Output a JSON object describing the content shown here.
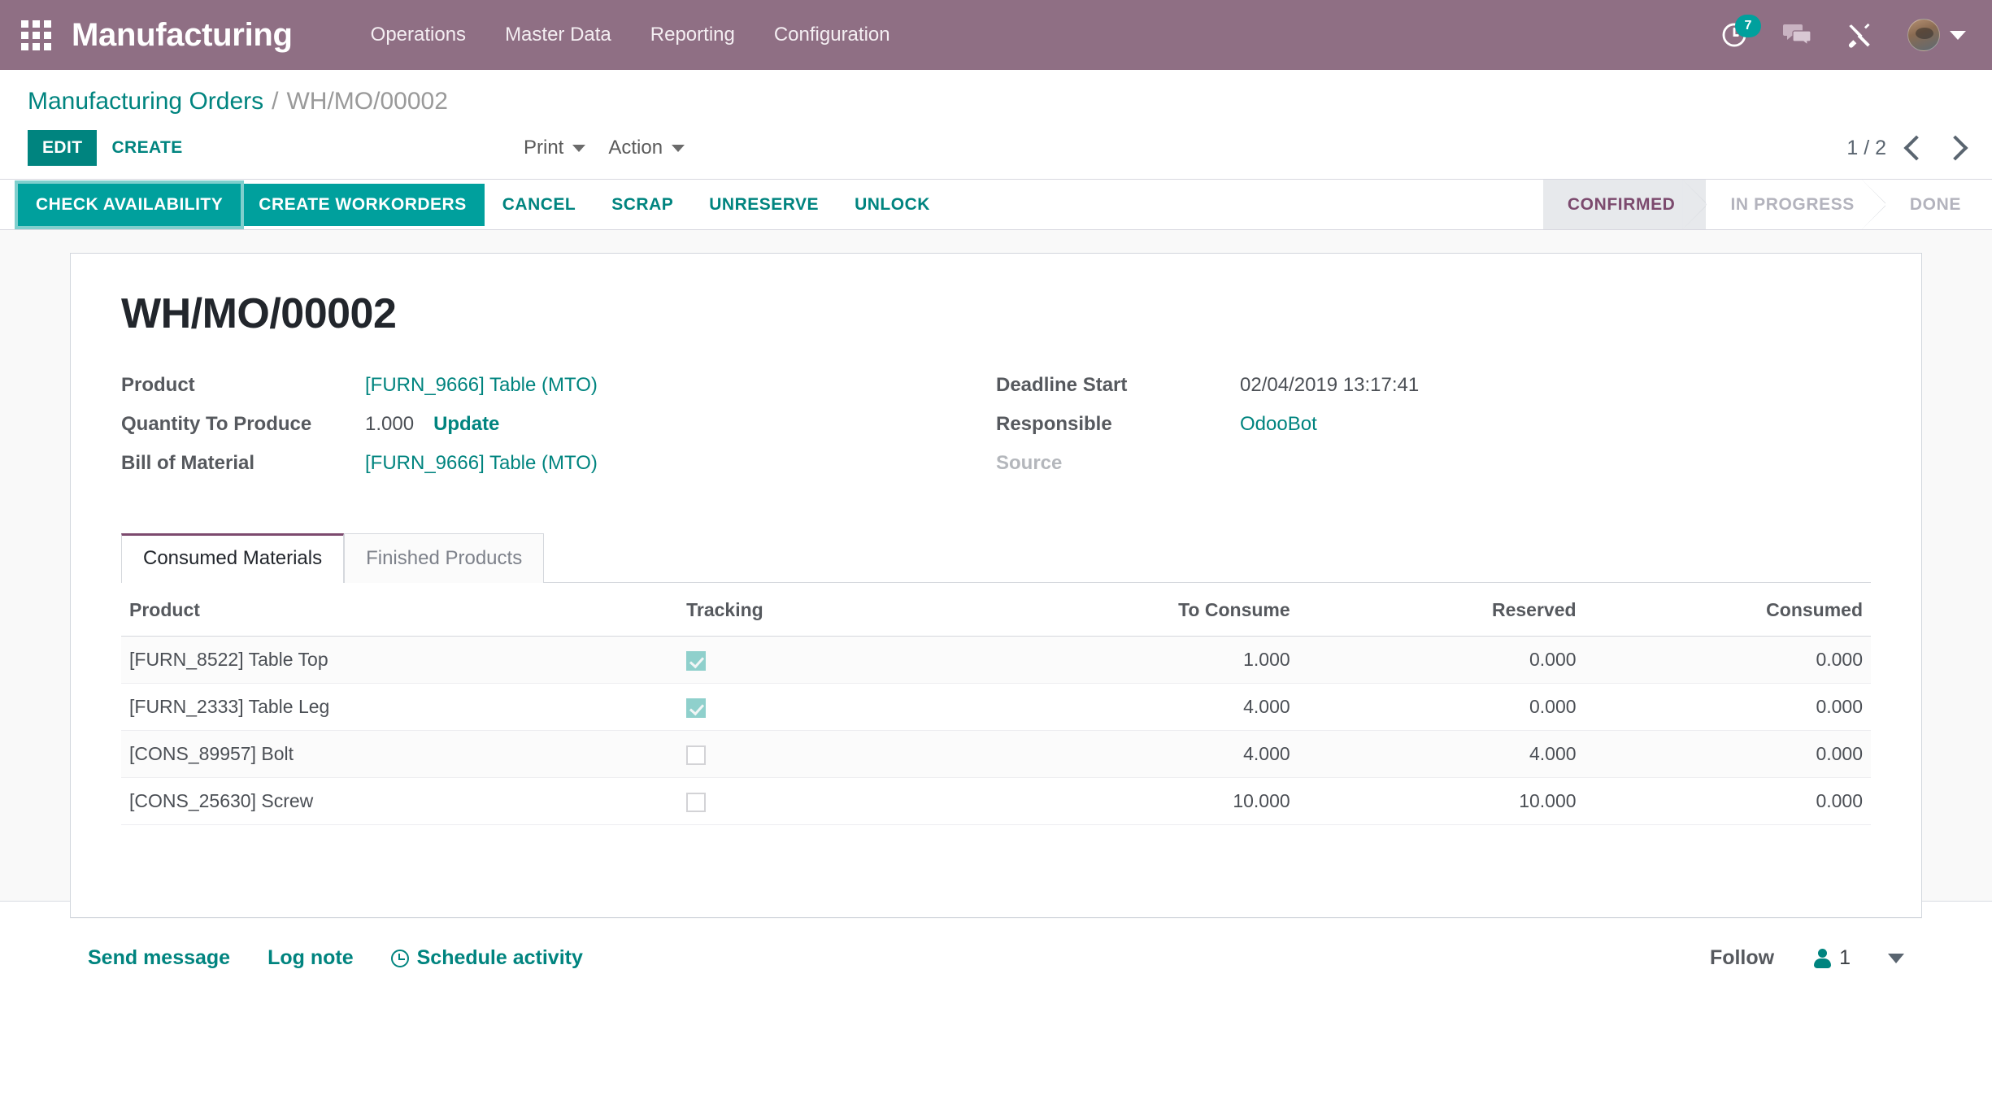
{
  "navbar": {
    "apps_icon": "apps-grid-icon",
    "brand": "Manufacturing",
    "menus": [
      {
        "label": "Operations"
      },
      {
        "label": "Master Data"
      },
      {
        "label": "Reporting"
      },
      {
        "label": "Configuration"
      }
    ],
    "activities_icon": "clock-icon",
    "activities_count": "7",
    "messages_icon": "chat-bubbles-icon",
    "debug_icon": "tools-icon",
    "avatar": "user-avatar",
    "user_caret": "chevron-down-icon"
  },
  "breadcrumb": {
    "root": "Manufacturing Orders",
    "separator": "/",
    "current": "WH/MO/00002"
  },
  "control_panel": {
    "edit_label": "EDIT",
    "create_label": "CREATE",
    "print_label": "Print",
    "action_label": "Action",
    "pager": "1 / 2",
    "prev_icon": "chevron-left-icon",
    "next_icon": "chevron-right-icon"
  },
  "status_bar": {
    "buttons": [
      {
        "label": "CHECK AVAILABILITY",
        "style": "focused"
      },
      {
        "label": "CREATE WORKORDERS",
        "style": "primary"
      },
      {
        "label": "CANCEL",
        "style": "link"
      },
      {
        "label": "SCRAP",
        "style": "link"
      },
      {
        "label": "UNRESERVE",
        "style": "link"
      },
      {
        "label": "UNLOCK",
        "style": "link"
      }
    ],
    "stages": [
      {
        "label": "CONFIRMED",
        "active": true
      },
      {
        "label": "IN PROGRESS",
        "active": false
      },
      {
        "label": "DONE",
        "active": false
      }
    ]
  },
  "form": {
    "record_title": "WH/MO/00002",
    "left_fields": [
      {
        "label": "Product",
        "value": "[FURN_9666] Table (MTO)",
        "kind": "link"
      },
      {
        "label": "Quantity To Produce",
        "value": "1.000",
        "kind": "plain",
        "extra_link": "Update"
      },
      {
        "label": "Bill of Material",
        "value": "[FURN_9666] Table (MTO)",
        "kind": "link"
      }
    ],
    "right_fields": [
      {
        "label": "Deadline Start",
        "value": "02/04/2019 13:17:41",
        "kind": "plain"
      },
      {
        "label": "Responsible",
        "value": "OdooBot",
        "kind": "link"
      },
      {
        "label": "Source",
        "value": "",
        "kind": "empty"
      }
    ]
  },
  "tabs": [
    {
      "label": "Consumed Materials",
      "active": true
    },
    {
      "label": "Finished Products",
      "active": false
    }
  ],
  "lines_table": {
    "columns": [
      "Product",
      "Tracking",
      "To Consume",
      "Reserved",
      "Consumed"
    ],
    "rows": [
      {
        "product": "[FURN_8522] Table Top",
        "tracking": true,
        "to_consume": "1.000",
        "reserved": "0.000",
        "consumed": "0.000",
        "danger": true
      },
      {
        "product": "[FURN_2333] Table Leg",
        "tracking": true,
        "to_consume": "4.000",
        "reserved": "0.000",
        "consumed": "0.000",
        "danger": true
      },
      {
        "product": "[CONS_89957] Bolt",
        "tracking": false,
        "to_consume": "4.000",
        "reserved": "4.000",
        "consumed": "0.000",
        "danger": false
      },
      {
        "product": "[CONS_25630] Screw",
        "tracking": false,
        "to_consume": "10.000",
        "reserved": "10.000",
        "consumed": "0.000",
        "danger": false
      }
    ]
  },
  "chatter": {
    "send_message": "Send message",
    "log_note": "Log note",
    "schedule_activity": "Schedule activity",
    "schedule_icon": "clock-icon",
    "follow_label": "Follow",
    "followers_icon": "person-icon",
    "followers_count": "1",
    "followers_caret": "chevron-down-icon"
  },
  "colors": {
    "brand_purple": "#8f6f84",
    "accent_teal": "#00847f",
    "primary_teal": "#00a09d",
    "danger_red": "#c0392b",
    "stage_active": "#7c4a6e"
  }
}
